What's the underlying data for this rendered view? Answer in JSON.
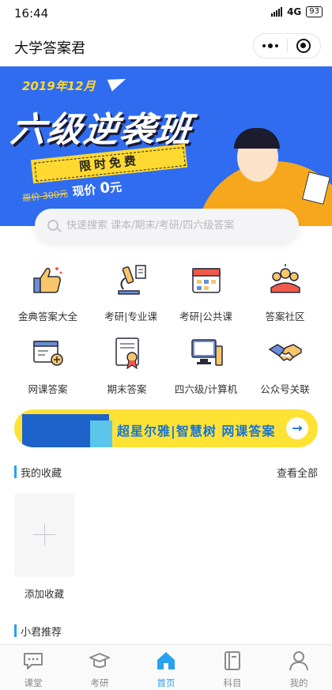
{
  "status_bar": {
    "time": "16:44",
    "network": "4G",
    "battery": "93"
  },
  "header": {
    "title": "大学答案君"
  },
  "banner": {
    "date": "2019年12月",
    "headline": "六级逆袭班",
    "tag": "限时免费",
    "old_price": "原价 300元",
    "new_price_prefix": "现价",
    "new_price_value": "0",
    "new_price_unit": "元"
  },
  "search": {
    "placeholder": "快速搜索 课本/期末/考研/四六级答案"
  },
  "grid": {
    "items": [
      {
        "label": "金典答案大全",
        "icon": "thumbs-up-icon"
      },
      {
        "label": "考研|专业课",
        "icon": "microscope-icon"
      },
      {
        "label": "考研|公共课",
        "icon": "calendar-icon"
      },
      {
        "label": "答案社区",
        "icon": "community-icon"
      },
      {
        "label": "网课答案",
        "icon": "online-course-icon"
      },
      {
        "label": "期末答案",
        "icon": "certificate-icon"
      },
      {
        "label": "四六级/计算机",
        "icon": "computer-icon"
      },
      {
        "label": "公众号关联",
        "icon": "handshake-icon"
      }
    ]
  },
  "promo": {
    "text": "超星尔雅|智慧树 网课答案",
    "arrow": "→"
  },
  "favorites": {
    "title": "我的收藏",
    "view_all": "查看全部",
    "add_label": "添加收藏"
  },
  "recommend": {
    "title": "小君推荐"
  },
  "tab_bar": {
    "items": [
      {
        "label": "课堂",
        "icon": "chat-icon",
        "active": false
      },
      {
        "label": "考研",
        "icon": "graduation-cap-icon",
        "active": false
      },
      {
        "label": "首页",
        "icon": "home-icon",
        "active": true
      },
      {
        "label": "科目",
        "icon": "book-icon",
        "active": false
      },
      {
        "label": "我的",
        "icon": "user-icon",
        "active": false
      }
    ]
  },
  "colors": {
    "accent": "#2aa0f0",
    "banner_bg": "#2f6cf0",
    "promo_bg": "#ffe234",
    "highlight": "#ffd930"
  }
}
